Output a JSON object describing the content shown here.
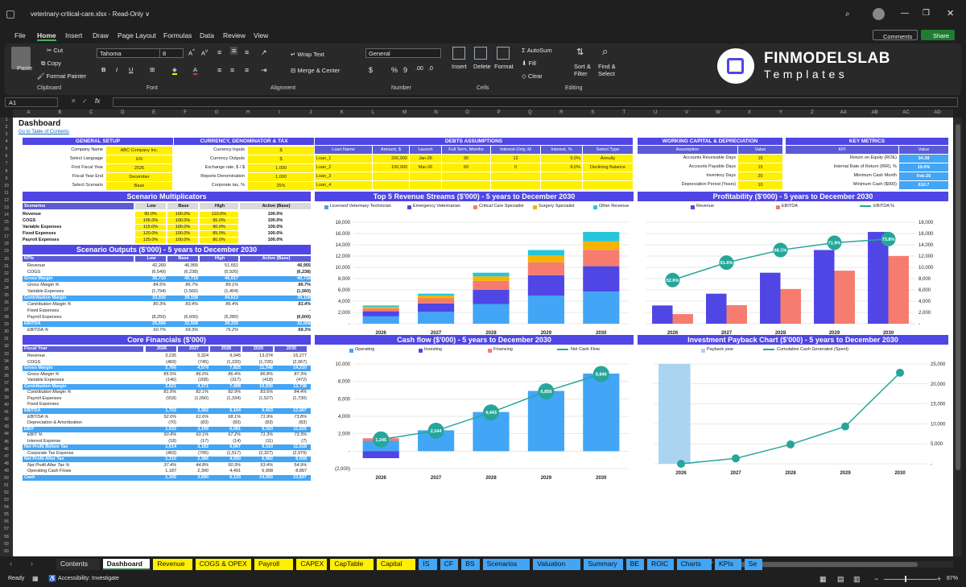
{
  "window": {
    "file_title": "veterinary-critical-care.xlsx",
    "mode": "Read-Only",
    "mode_chevron": "∨"
  },
  "menu": [
    "File",
    "Home",
    "Insert",
    "Draw",
    "Page Layout",
    "Formulas",
    "Data",
    "Review",
    "View"
  ],
  "actions": {
    "comments": "Comments",
    "share": "Share"
  },
  "ribbon": {
    "clipboard": {
      "paste": "Paste",
      "cut": "Cut",
      "copy": "Copy",
      "format_painter": "Format Painter",
      "group": "Clipboard"
    },
    "font": {
      "name": "Tahoma",
      "size": "8",
      "group": "Font"
    },
    "alignment": {
      "wrap": "Wrap Text",
      "merge": "Merge & Center",
      "group": "Alignment"
    },
    "number": {
      "format": "General",
      "group": "Number"
    },
    "cells": {
      "insert": "Insert",
      "delete": "Delete",
      "format": "Format",
      "group": "Cells"
    },
    "editing": {
      "autosum": "AutoSum",
      "fill": "Fill",
      "clear": "Clear",
      "sort": "Sort &",
      "filter": "Filter",
      "find": "Find &",
      "select": "Select",
      "group": "Editing"
    }
  },
  "brand": {
    "name": "FINMODELSLAB",
    "sub": "Templates"
  },
  "namebox": "A1",
  "fx": "fx",
  "columns": [
    "A",
    "B",
    "C",
    "D",
    "E",
    "F",
    "G",
    "H",
    "I",
    "J",
    "K",
    "L",
    "M",
    "N",
    "O",
    "P",
    "Q",
    "R",
    "S",
    "T",
    "U",
    "V",
    "W",
    "X",
    "Y",
    "Z",
    "AA",
    "AB",
    "AC",
    "AD"
  ],
  "sheet": {
    "title": "Dashboard",
    "toc_link": "Go to Table of Contents",
    "general": {
      "title": "GENERAL SETUP",
      "rows": [
        [
          "Company Name",
          "ABC Company Inc."
        ],
        [
          "Select Language",
          "EN"
        ],
        [
          "First Fiscal Year",
          "2026"
        ],
        [
          "Fiscal Year End",
          "December"
        ],
        [
          "Select Scenario",
          "Base"
        ]
      ]
    },
    "currency": {
      "title": "CURRENCY, DENOMINATOR & TAX",
      "rows": [
        [
          "Currency Inputs",
          "$"
        ],
        [
          "Currency Outputs",
          "$"
        ],
        [
          "Exchange rate, $ / $",
          "1.000"
        ],
        [
          "Reports Denomination",
          "1.000"
        ],
        [
          "Corporate tax, %",
          "25%"
        ]
      ]
    },
    "debts": {
      "title": "DEBTS ASSUMPTIONS",
      "headers": [
        "Loan Name",
        "Amount, $",
        "Launch",
        "Full Term, Months",
        "Interest-Only, M",
        "Interest, %",
        "Select Type"
      ],
      "rows": [
        [
          "Loan_1",
          "200,000",
          "Jan-26",
          "90",
          "12",
          "6.0%",
          "Annuity"
        ],
        [
          "Loan_2",
          "100,000",
          "Mar-26",
          "60",
          "0",
          "8.0%",
          "Declining Balance"
        ],
        [
          "Loan_3",
          "",
          "",
          "",
          "",
          "",
          ""
        ],
        [
          "Loan_4",
          "",
          "",
          "",
          "",
          "",
          ""
        ]
      ]
    },
    "wc": {
      "title": "WORKING CAPITAL & DEPRECIATION",
      "headers": [
        "Assumption",
        "Value"
      ],
      "rows": [
        [
          "Accounts Receivable Days",
          "15"
        ],
        [
          "Accounts Payable Days",
          "15"
        ],
        [
          "Inventory Days",
          "20"
        ],
        [
          "Depreciation Period (Years)",
          "10"
        ]
      ]
    },
    "kpi": {
      "title": "KEY METRICS",
      "headers": [
        "KPI",
        "Value"
      ],
      "rows": [
        [
          "Return on Equity (ROE)",
          "34.38"
        ],
        [
          "Internal Rate of Return (IRR), %",
          "19.0%"
        ],
        [
          "Minimum Cash Month",
          "Feb-26"
        ],
        [
          "Minimum Cash ($000)",
          "610.7"
        ]
      ]
    },
    "multipliers": {
      "title": "Scenario Multiplicators",
      "headers": [
        "Scenarios",
        "Low",
        "Base",
        "High",
        "Active (Base)"
      ],
      "rows": [
        [
          "Revenue",
          "90.0%",
          "100.0%",
          "110.0%",
          "100.0%"
        ],
        [
          "COGS",
          "105.0%",
          "100.0%",
          "95.0%",
          "100.0%"
        ],
        [
          "Variable Expenses",
          "115.0%",
          "100.0%",
          "90.0%",
          "100.0%"
        ],
        [
          "Fixed Expenses",
          "120.0%",
          "100.0%",
          "85.0%",
          "100.0%"
        ],
        [
          "Payroll Expenses",
          "125.0%",
          "100.0%",
          "80.0%",
          "100.0%"
        ]
      ]
    },
    "outputs": {
      "title": "Scenario Outputs ($'000) - 5 years to December 2030",
      "headers": [
        "KPIs",
        "Low",
        "Base",
        "High",
        "Active (Base)"
      ],
      "rows": [
        [
          "Revenue",
          "42,260",
          "46,955",
          "51,651",
          "46,955",
          "n"
        ],
        [
          "COGS",
          "(6,549)",
          "(6,238)",
          "(5,926)",
          "(6,238)",
          "n"
        ],
        [
          "Gross Margin",
          "35,710",
          "40,718",
          "46,017",
          "40,718",
          "h"
        ],
        [
          "Gross Margin %",
          "84.5%",
          "86.7%",
          "89.1%",
          "86.7%",
          "i"
        ],
        [
          "Variable Expenses",
          "(1,794)",
          "(1,560)",
          "(1,404)",
          "(1,560)",
          "n"
        ],
        [
          "Contribution Margin",
          "33,916",
          "39,158",
          "44,613",
          "39,158",
          "h"
        ],
        [
          "Contribution Margin %",
          "80.3%",
          "83.4%",
          "86.4%",
          "83.4%",
          "i"
        ],
        [
          "Fixed Expenses",
          "-",
          "-",
          "-",
          "-",
          "n"
        ],
        [
          "Payroll Expenses",
          "(8,250)",
          "(6,600)",
          "(5,280)",
          "(6,600)",
          "n"
        ],
        [
          "EBITDA",
          "25,666",
          "32,558",
          "39,333",
          "32,558",
          "h"
        ],
        [
          "EBITDA %",
          "60.7%",
          "69.3%",
          "76.2%",
          "69.3%",
          "i"
        ]
      ]
    },
    "core": {
      "title": "Core Financials ($'000)",
      "headers": [
        "Fiscal Year",
        "2026",
        "2027",
        "2028",
        "2029",
        "2030"
      ],
      "rows": [
        [
          "Revenue",
          "3,235",
          "5,324",
          "9,045",
          "13,074",
          "16,277",
          "n"
        ],
        [
          "COGS",
          "(469)",
          "(745)",
          "(1,220)",
          "(1,726)",
          "(2,067)",
          "n"
        ],
        [
          "Gross Margin",
          "2,766",
          "4,579",
          "7,825",
          "11,348",
          "14,210",
          "h"
        ],
        [
          "Gross Margin %",
          "85.5%",
          "86.0%",
          "86.4%",
          "86.8%",
          "87.3%",
          "i"
        ],
        [
          "Variable Expenses",
          "(146)",
          "(208)",
          "(317)",
          "(418)",
          "(472)",
          "n"
        ],
        [
          "Contribution Margin",
          "2,621",
          "4,371",
          "7,498",
          "10,930",
          "13,738",
          "h"
        ],
        [
          "Contribution Margin %",
          "81.0%",
          "82.1%",
          "82.9%",
          "83.6%",
          "84.4%",
          "i"
        ],
        [
          "Payroll Expenses",
          "(918)",
          "(1,090)",
          "(1,334)",
          "(1,527)",
          "(1,730)",
          "n"
        ],
        [
          "Fixed Expenses",
          "",
          "",
          "",
          "",
          "",
          "n"
        ],
        [
          "EBITDA",
          "1,702",
          "3,282",
          "6,164",
          "9,403",
          "12,007",
          "h"
        ],
        [
          "EBITDA %",
          "52.6%",
          "61.6%",
          "68.1%",
          "71.9%",
          "73.8%",
          "i"
        ],
        [
          "Depreciation & Amortization",
          "(70)",
          "(83)",
          "(83)",
          "(83)",
          "(83)",
          "n"
        ],
        [
          "EBIT",
          "1,632",
          "3,199",
          "6,081",
          "9,320",
          "11,925",
          "h"
        ],
        [
          "EBIT %",
          "50.4%",
          "60.1%",
          "67.2%",
          "71.3%",
          "73.3%",
          "i"
        ],
        [
          "Interest Expense",
          "(18)",
          "(17)",
          "(14)",
          "(11)",
          "(7)",
          "n"
        ],
        [
          "Net Profit Before Tax",
          "1,614",
          "3,182",
          "6,067",
          "9,310",
          "11,918",
          "h"
        ],
        [
          "Corporate Tax Expense",
          "(403)",
          "(795)",
          "(1,517)",
          "(2,327)",
          "(2,979)",
          "n"
        ],
        [
          "Net Profit After Tax",
          "1,210",
          "2,386",
          "4,550",
          "6,982",
          "8,938",
          "h"
        ],
        [
          "Net Profit After Tax %",
          "37.4%",
          "44.8%",
          "50.3%",
          "53.4%",
          "54.9%",
          "i"
        ],
        [
          "Operating Cash Flows",
          "1,187",
          "2,390",
          "4,491",
          "6,908",
          "8,897",
          "n"
        ],
        [
          "Cash",
          "1,345",
          "3,690",
          "6,133",
          "14,993",
          "23,837",
          "h"
        ]
      ]
    }
  },
  "chart_data": [
    {
      "type": "bar",
      "title": "Top 5 Revenue Streams ($'000) - 5 years to December 2030",
      "categories": [
        "2026",
        "2027",
        "2028",
        "2029",
        "2030"
      ],
      "stacked": true,
      "ylim": [
        0,
        18000
      ],
      "yticks": [
        "-",
        "2,000",
        "4,000",
        "6,000",
        "8,000",
        "10,000",
        "12,000",
        "14,000",
        "16,000",
        "18,000"
      ],
      "series": [
        {
          "name": "Licensed Veterinary Technician",
          "color": "#42a5f5",
          "values": [
            1300,
            2100,
            3500,
            5000,
            5700
          ]
        },
        {
          "name": "Emergency Veterinarian",
          "color": "#4f46e5",
          "values": [
            900,
            1500,
            2500,
            3600,
            4500
          ]
        },
        {
          "name": "Critical Care Specialist",
          "color": "#f57c6e",
          "values": [
            500,
            900,
            1600,
            2300,
            2900
          ]
        },
        {
          "name": "Surgery Specialist",
          "color": "#f5b400",
          "values": [
            300,
            500,
            800,
            1200,
            1500
          ]
        },
        {
          "name": "Other Revenue",
          "color": "#26c6da",
          "values": [
            235,
            324,
            645,
            974,
            1677
          ]
        }
      ]
    },
    {
      "type": "bar",
      "title": "Profitability ($'000) - 5 years to December 2030",
      "categories": [
        "2026",
        "2027",
        "2028",
        "2029",
        "2030"
      ],
      "ylim": [
        0,
        18000
      ],
      "yticks": [
        "-",
        "2,000",
        "4,000",
        "6,000",
        "8,000",
        "10,000",
        "12,000",
        "14,000",
        "16,000",
        "18,000"
      ],
      "series": [
        {
          "name": "Revenue",
          "color": "#4f46e5",
          "values": [
            3235,
            5324,
            9045,
            13074,
            16277
          ]
        },
        {
          "name": "EBITDA",
          "color": "#f57c6e",
          "values": [
            1702,
            3282,
            6164,
            9403,
            12007
          ]
        },
        {
          "name": "EBITDA %",
          "color": "#26a69a",
          "values": [
            52.6,
            61.6,
            68.1,
            71.9,
            73.8
          ],
          "labels": [
            "52.6%",
            "61.6%",
            "68.1%",
            "71.9%",
            "73.8%"
          ]
        }
      ]
    },
    {
      "type": "bar",
      "title": "Cash flow ($'000) - 5 years to December 2030",
      "categories": [
        "2026",
        "2027",
        "2028",
        "2029",
        "2030"
      ],
      "ylim": [
        -2000,
        10000
      ],
      "yticks": [
        "(2,000)",
        "-",
        "2,000",
        "4,000",
        "6,000",
        "8,000",
        "10,000"
      ],
      "series": [
        {
          "name": "Operating",
          "color": "#42a5f5",
          "values": [
            1187,
            2390,
            4491,
            6908,
            8897
          ]
        },
        {
          "name": "Investing",
          "color": "#4f46e5",
          "values": [
            -800,
            0,
            0,
            0,
            0
          ]
        },
        {
          "name": "Financing",
          "color": "#f57c6e",
          "values": [
            300,
            0,
            0,
            0,
            0
          ]
        },
        {
          "name": "Net Cash Flow",
          "color": "#26a69a",
          "values": [
            1345,
            2344,
            4443,
            6858,
            8846
          ],
          "labels": [
            "1,345",
            "2,344",
            "4,443",
            "6,858",
            "8,846"
          ]
        }
      ]
    },
    {
      "type": "line",
      "title": "Investment Payback Chart ($'000) - 5 years to December 2030",
      "categories": [
        "2026",
        "2027",
        "2028",
        "2029",
        "2030"
      ],
      "ylim": [
        0,
        25000
      ],
      "yticks": [
        "-",
        "5,000",
        "10,000",
        "15,000",
        "20,000",
        "25,000"
      ],
      "series": [
        {
          "name": "Payback year",
          "color": "#aad4ef",
          "values": [
            1,
            0,
            0,
            0,
            0
          ]
        },
        {
          "name": "Cumulative Cash Generated (Spent)",
          "color": "#26a69a",
          "values": [
            0,
            1350,
            4850,
            9350,
            22800
          ]
        }
      ]
    }
  ],
  "tabs": [
    {
      "label": "Contents",
      "c": "#2b2b2b",
      "t": "#e6e6e6"
    },
    {
      "label": "Dashboard",
      "c": "#ffffff",
      "t": "#111",
      "active": true
    },
    {
      "label": "Revenue",
      "c": "#ffef00"
    },
    {
      "label": "COGS & OPEX",
      "c": "#ffef00"
    },
    {
      "label": "Payroll",
      "c": "#ffef00"
    },
    {
      "label": "CAPEX",
      "c": "#ffef00"
    },
    {
      "label": "CapTable",
      "c": "#ffef00"
    },
    {
      "label": "Capital",
      "c": "#ffef00"
    },
    {
      "label": "IS",
      "c": "#42a5f5"
    },
    {
      "label": "CF",
      "c": "#42a5f5"
    },
    {
      "label": "BS",
      "c": "#42a5f5"
    },
    {
      "label": "Scenarios",
      "c": "#42a5f5"
    },
    {
      "label": "Valuation",
      "c": "#42a5f5"
    },
    {
      "label": "Summary",
      "c": "#42a5f5"
    },
    {
      "label": "BE",
      "c": "#42a5f5"
    },
    {
      "label": "ROIC",
      "c": "#42a5f5"
    },
    {
      "label": "Charts",
      "c": "#42a5f5"
    },
    {
      "label": "KPIs",
      "c": "#42a5f5"
    },
    {
      "label": "Se",
      "c": "#42a5f5"
    }
  ],
  "statusbar": {
    "ready": "Ready",
    "accessibility": "Accessibility: Investigate",
    "zoom": "87%"
  }
}
